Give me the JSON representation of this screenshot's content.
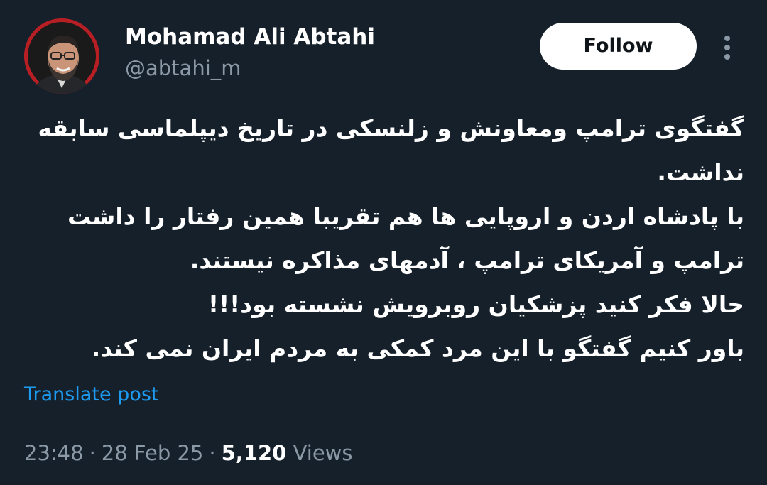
{
  "author": {
    "display_name": "Mohamad Ali Abtahi",
    "handle": "@abtahi_m",
    "avatar_icon": "profile-photo"
  },
  "header": {
    "follow_label": "Follow",
    "more_icon": "vertical-ellipsis-icon"
  },
  "tweet": {
    "lines": [
      "گفتگوی ترامپ ومعاونش و زلنسکی در تاریخ دیپلماسی سابقه",
      "نداشت.",
      "با پادشاه اردن و اروپایی ها هم تقریبا همین رفتار را داشت",
      "ترامپ و آمریکای ترامپ ، آدمهای مذاکره نیستند.",
      "حالا فکر کنید پزشکیان روبرویش نشسته بود!!!",
      "باور کنیم گفتگو با این مرد کمکی به مردم ایران نمی کند."
    ],
    "translate_label": "Translate post"
  },
  "meta": {
    "time": "23:48",
    "separator": "·",
    "date": "28 Feb 25",
    "views_count": "5,120",
    "views_label": "Views"
  },
  "colors": {
    "background": "#15202b",
    "text_primary": "#ffffff",
    "text_secondary": "#8b98a5",
    "link": "#1d9bf0",
    "avatar_ring": "#b81f24"
  }
}
